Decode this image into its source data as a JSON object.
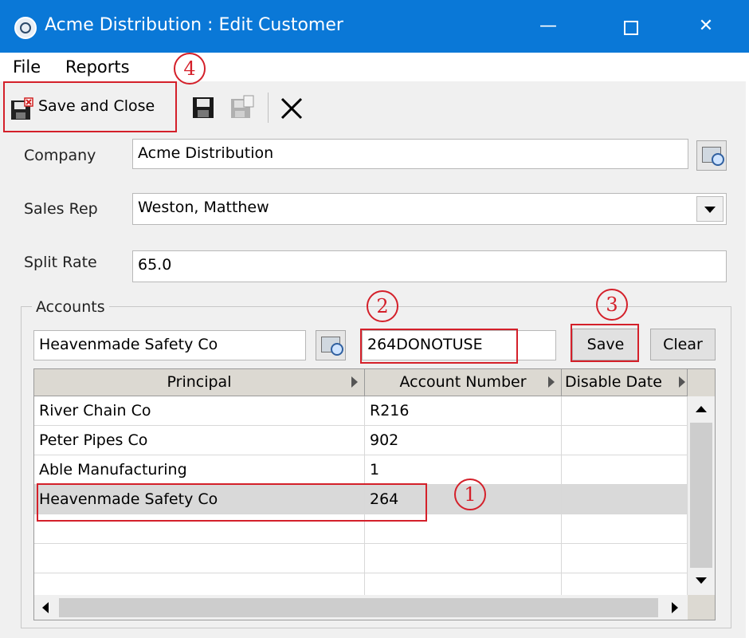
{
  "window": {
    "title": "Acme Distribution : Edit Customer"
  },
  "menu": {
    "file": "File",
    "reports": "Reports"
  },
  "toolbar": {
    "save_and_close": "Save and Close"
  },
  "form": {
    "company_label": "Company",
    "company_value": "Acme Distribution",
    "sales_rep_label": "Sales Rep",
    "sales_rep_value": "Weston, Matthew",
    "split_rate_label": "Split Rate",
    "split_rate_value": "65.0"
  },
  "accounts": {
    "label": "Accounts",
    "principal_value": "Heavenmade Safety Co",
    "account_value": "264DONOTUSE",
    "save_label": "Save",
    "clear_label": "Clear",
    "columns": [
      "Principal",
      "Account Number",
      "Disable Date"
    ],
    "rows": [
      {
        "principal": "River Chain Co",
        "account": "R216"
      },
      {
        "principal": "Peter Pipes Co",
        "account": "902"
      },
      {
        "principal": "Able Manufacturing",
        "account": "1"
      },
      {
        "principal": "Heavenmade Safety Co",
        "account": "264"
      }
    ]
  },
  "annotations": [
    "1",
    "2",
    "3",
    "4"
  ],
  "colors": {
    "titlebar": "#0a78d7",
    "annotation": "#d4202a"
  }
}
